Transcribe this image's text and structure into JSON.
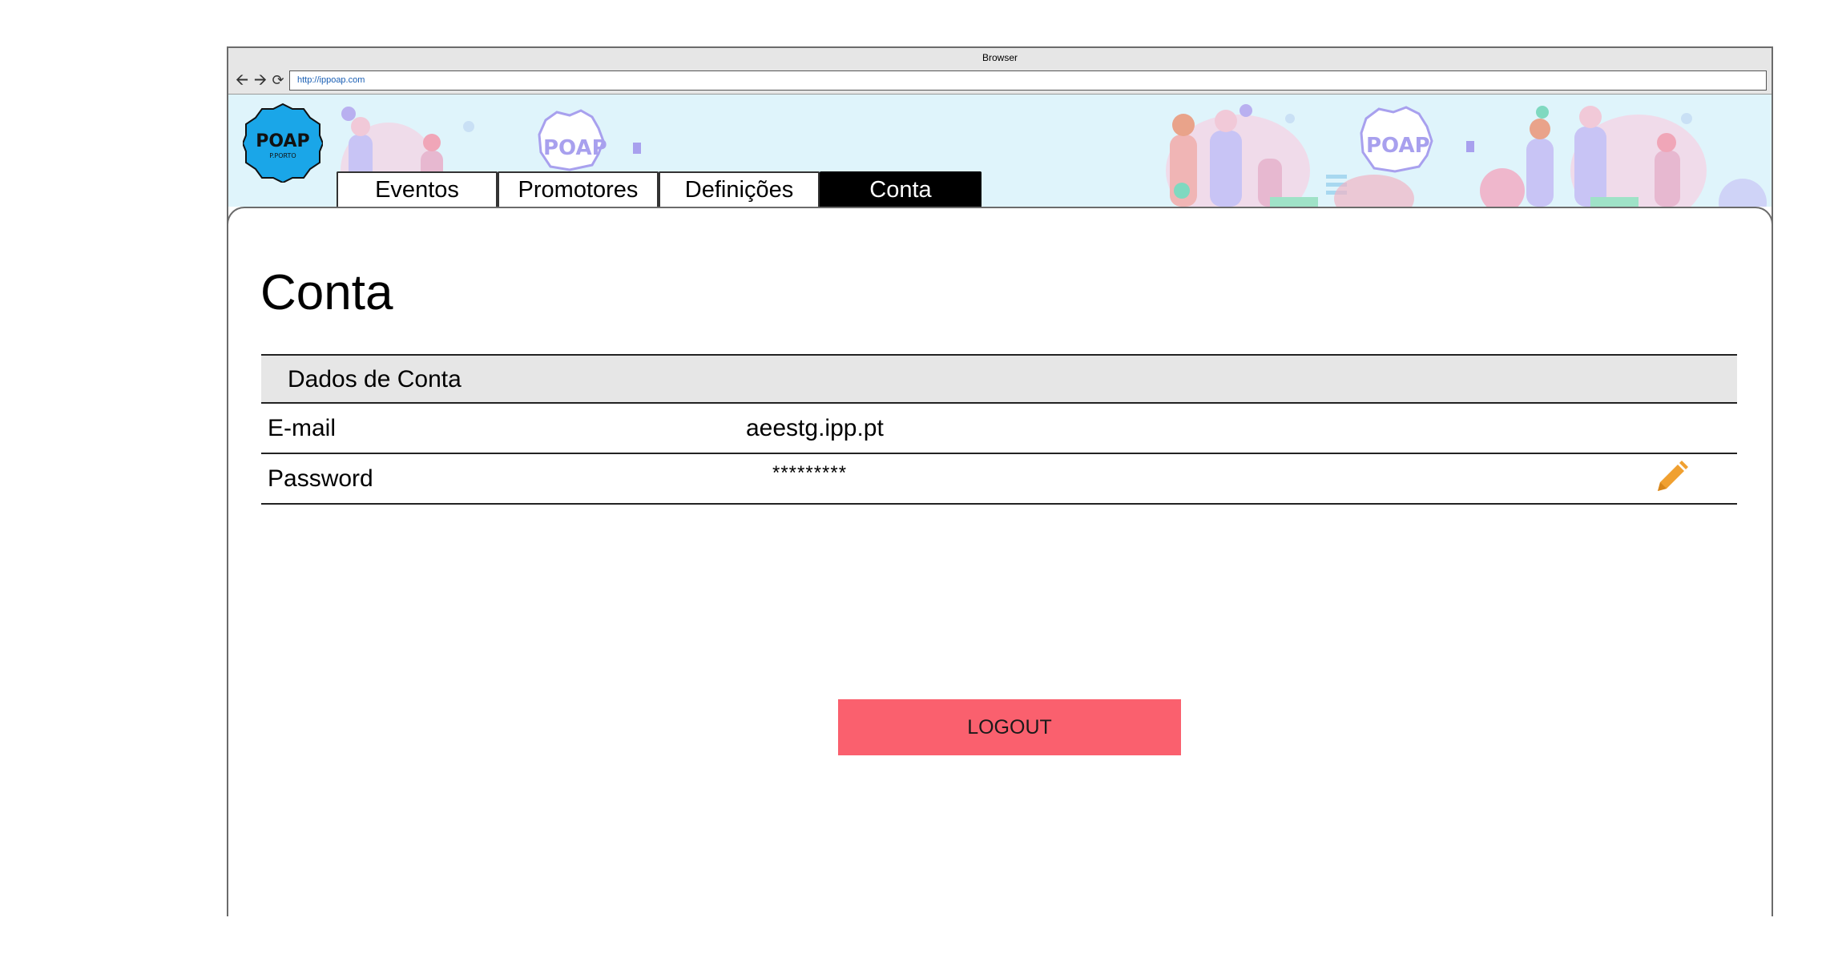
{
  "browser": {
    "title": "Browser",
    "url": "http://ippoap.com",
    "nav": {
      "back_icon": "arrow-left-icon",
      "forward_icon": "arrow-right-icon",
      "reload_icon": "reload-icon"
    }
  },
  "banner": {
    "logo_text": "POAP",
    "logo_subtext": "P.PORTO",
    "illustration_text": "POAP"
  },
  "tabs": [
    {
      "label": "Eventos",
      "active": false
    },
    {
      "label": "Promotores",
      "active": false
    },
    {
      "label": "Definições",
      "active": false
    },
    {
      "label": "Conta",
      "active": true
    }
  ],
  "page": {
    "title": "Conta",
    "section_title": "Dados de Conta",
    "rows": [
      {
        "label": "E-mail",
        "value": "aeestg.ipp.pt"
      },
      {
        "label": "Password",
        "value": "*********"
      }
    ],
    "edit_icon": "pencil-icon",
    "logout_label": "LOGOUT"
  },
  "colors": {
    "banner_bg": "#dff4fb",
    "logo_blue": "#1aa6e8",
    "active_tab": "#000000",
    "logout": "#fa606e",
    "edit_icon": "#f0a030"
  }
}
